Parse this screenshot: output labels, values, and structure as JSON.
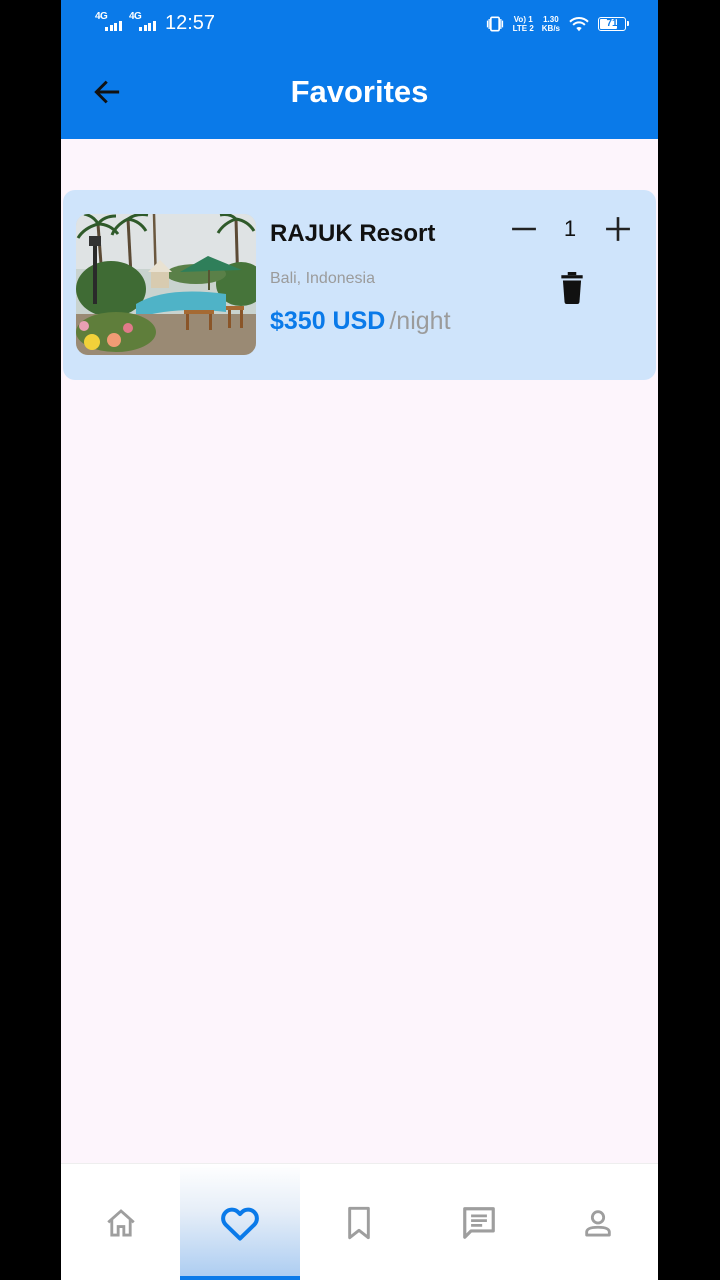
{
  "status_bar": {
    "network1": "4G",
    "network2": "4G",
    "time": "12:57",
    "volte_line1": "Vo) 1",
    "volte_line2": "LTE 2",
    "speed_value": "1.30",
    "speed_unit": "KB/s",
    "battery": "71",
    "battery_level": 0.71
  },
  "app_bar": {
    "title": "Favorites",
    "back_icon": "arrow-left-icon"
  },
  "favorites": [
    {
      "name": "RAJUK Resort",
      "location": "Bali, Indonesia",
      "price": "$350 USD",
      "per": "/night",
      "quantity": "1",
      "image": "resort-pool-photo"
    }
  ],
  "bottom_nav": {
    "items": [
      {
        "icon": "home-icon",
        "active": false
      },
      {
        "icon": "heart-icon",
        "active": true
      },
      {
        "icon": "bookmark-icon",
        "active": false
      },
      {
        "icon": "chat-icon",
        "active": false
      },
      {
        "icon": "person-icon",
        "active": false
      }
    ]
  },
  "colors": {
    "primary": "#0a7ae9",
    "card_bg": "#cfe4fb",
    "page_bg": "#fdf5fc",
    "muted_text": "#9b9b9b",
    "inactive_icon": "#9e9e9e"
  }
}
